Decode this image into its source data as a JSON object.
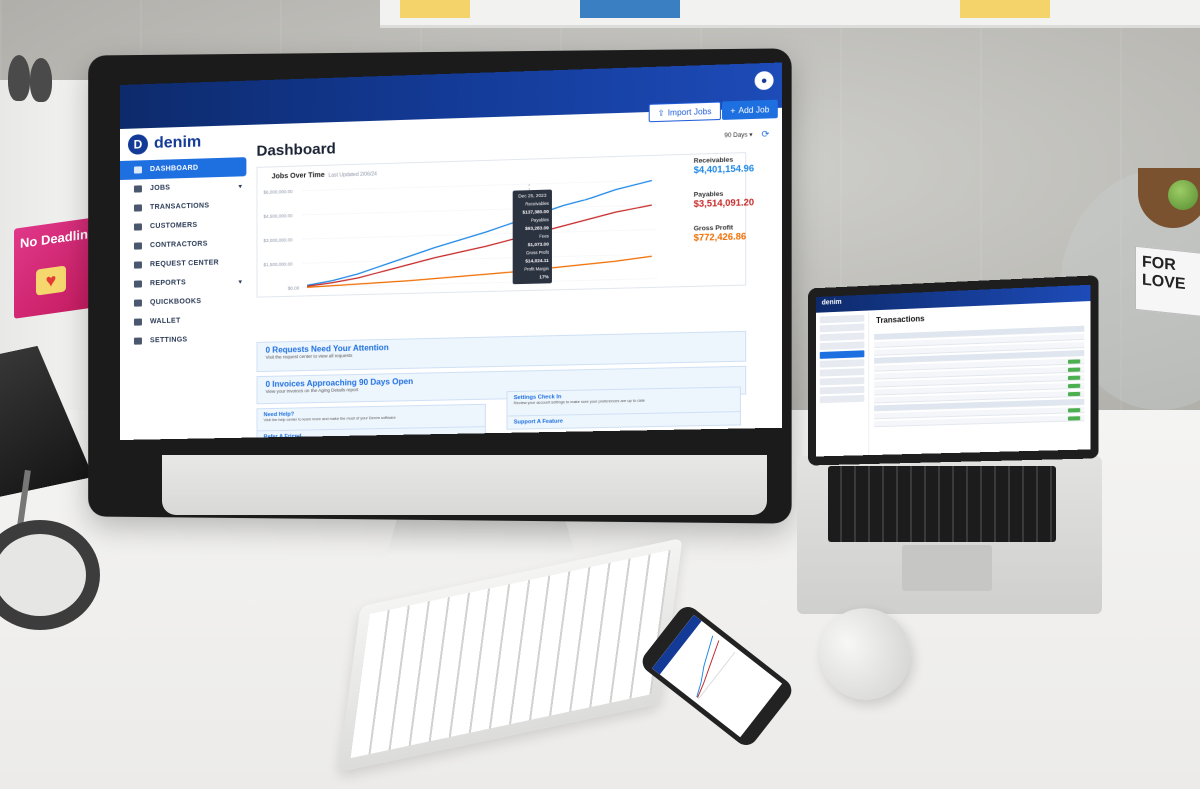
{
  "app": {
    "logo": "denim",
    "title": "Dashboard",
    "range": "90 Days",
    "buttons": {
      "import": "Import Jobs",
      "add": "Add Job"
    }
  },
  "sidebar": {
    "items": [
      {
        "label": "DASHBOARD",
        "active": true
      },
      {
        "label": "JOBS",
        "chevron": true
      },
      {
        "label": "TRANSACTIONS"
      },
      {
        "label": "CUSTOMERS"
      },
      {
        "label": "CONTRACTORS"
      },
      {
        "label": "REQUEST CENTER"
      },
      {
        "label": "REPORTS",
        "chevron": true
      },
      {
        "label": "QUICKBOOKS"
      },
      {
        "label": "WALLET"
      },
      {
        "label": "SETTINGS"
      }
    ]
  },
  "chart": {
    "title": "Jobs Over Time",
    "updated": "Last Updated 2/06/24",
    "tooltip": {
      "date": "Dec 25, 2023",
      "receivables_label": "Receivables",
      "receivables": "$137,380.00",
      "payables_label": "Payables",
      "payables": "$93,283.09",
      "fees_label": "Fees",
      "fees": "$1,073.00",
      "profit_label": "Gross Profit",
      "profit": "$14,024.11",
      "margin_label": "Profit Margin",
      "margin": "17%"
    },
    "yticks": [
      "$6,000,000.00",
      "$4,500,000.00",
      "$3,000,000.00",
      "$1,500,000.00",
      "$0.00"
    ]
  },
  "metrics": {
    "receivables_label": "Receivables",
    "receivables": "$4,401,154.96",
    "payables_label": "Payables",
    "payables": "$3,514,091.20",
    "profit_label": "Gross Profit",
    "profit": "$772,426.86",
    "colors": {
      "receivables": "#1e88e5",
      "payables": "#c62828",
      "profit": "#ef6c00"
    }
  },
  "notices": {
    "requests_title": "0 Requests Need Your Attention",
    "requests_sub": "Visit the request center to view all requests",
    "invoices_title": "0 Invoices Approaching 90 Days Open",
    "invoices_sub": "View your invoices on the Aging Details report",
    "help_title": "Need Help?",
    "help_sub": "Visit the help center to learn more and make the most of your Denim software",
    "settings_title": "Settings Check In",
    "settings_sub": "Review your account settings to make sure your preferences are up to date",
    "refer_title": "Refer A Friend",
    "support_title": "Support A Feature"
  },
  "laptop": {
    "title": "Transactions",
    "logo": "denim"
  },
  "decor": {
    "book_left": "No Deadline",
    "book_right": "FOR LOVE"
  }
}
